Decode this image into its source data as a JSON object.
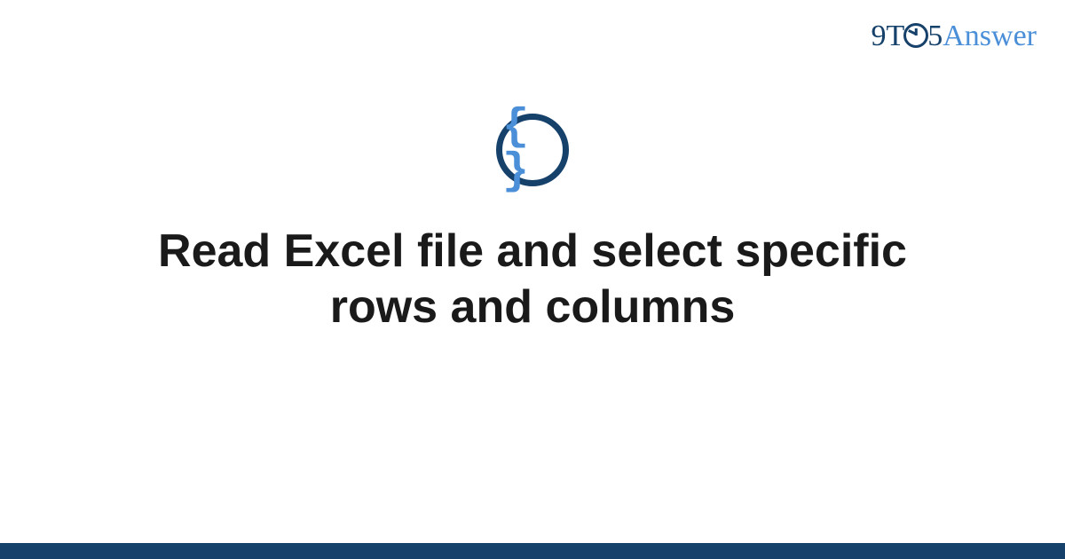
{
  "logo": {
    "prefix": "9T",
    "middle_numeral": "5",
    "suffix": "Answer"
  },
  "icon": {
    "glyph": "{ }",
    "name": "code-braces"
  },
  "title": "Read Excel file and select specific rows and columns",
  "colors": {
    "brand_dark": "#16416a",
    "brand_light": "#4a8fd8",
    "text": "#1a1a1a"
  }
}
